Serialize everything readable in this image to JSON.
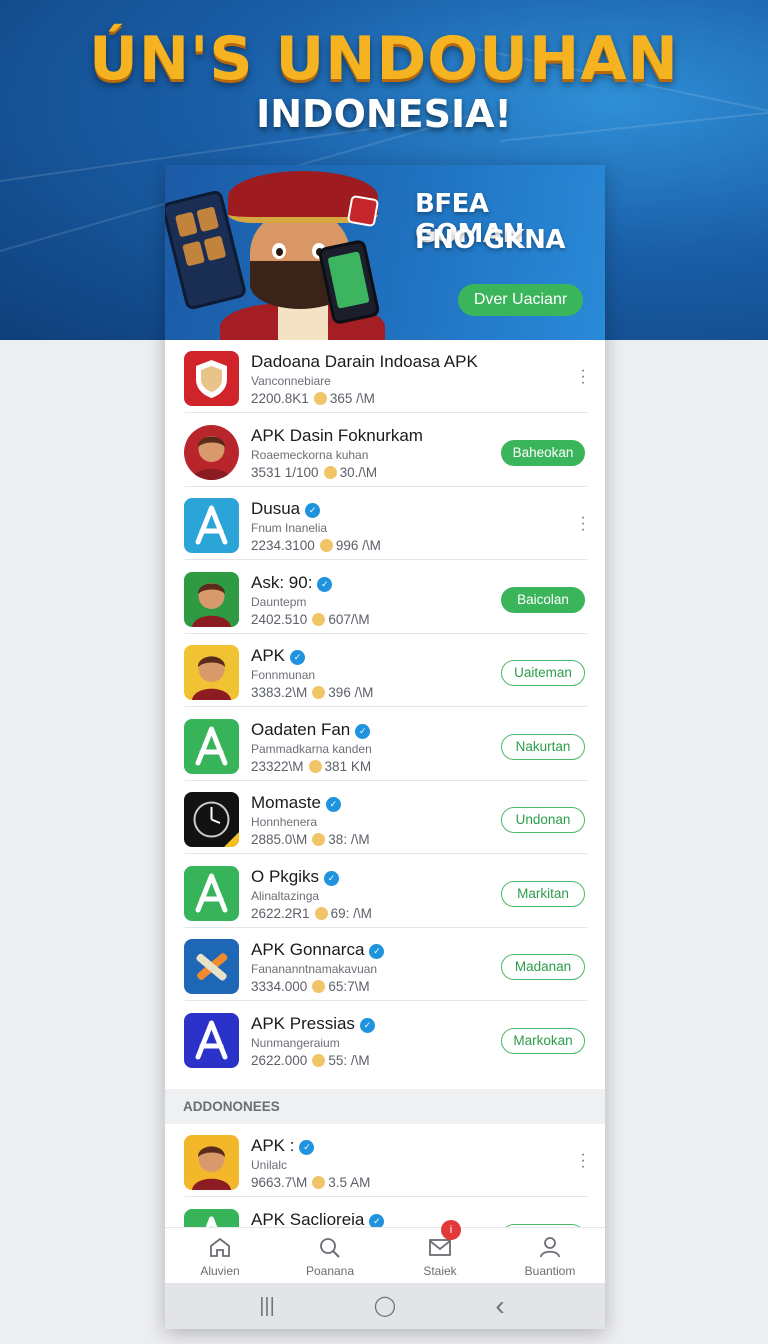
{
  "hero": {
    "title": "ÚN'S UNDOUHAN",
    "subtitle": "INDONESIA!"
  },
  "banner": {
    "line1": "BFEA GOMAN",
    "line2": "FNO GKNA",
    "button_label": "Dver Uacianr"
  },
  "apps": [
    {
      "name": "Dadoana Darain Indoasa APK",
      "developer": "Vanconnebiare",
      "downloads": "2200.8K1",
      "size": "365 /\\M",
      "action": "menu",
      "icon": "shield-icon",
      "icon_color": "#d0232a"
    },
    {
      "name": "APK Dasin Foknurkam",
      "developer": "Roaemeckorna kuhan",
      "downloads": "3531 1/100",
      "size": "30./\\M",
      "action": "solid",
      "button_label": "Baheokan",
      "icon": "avatar-icon",
      "icon_color": "#b8262c"
    },
    {
      "name": "Dusua",
      "developer": "Fnum Inanelia",
      "downloads": "2234.3100",
      "size": "996 /\\M",
      "action": "menu",
      "icon": "app-store-icon",
      "icon_color": "#2ba4d8"
    },
    {
      "name": "Ask: 90:",
      "developer": "Dauntepm",
      "downloads": "2402.510",
      "size": "607/\\M",
      "action": "solid",
      "button_label": "Baicolan",
      "icon": "avatar-icon",
      "icon_color": "#2e9b43"
    },
    {
      "name": "APK",
      "developer": "Fonnmunan",
      "downloads": "3383.2\\M",
      "size": "396 /\\M",
      "action": "outline",
      "button_label": "Uaiteman",
      "icon": "avatar-icon",
      "icon_color": "#f1c232"
    },
    {
      "name": "Oadaten Fan",
      "developer": "Pammadkarna kanden",
      "downloads": "23322\\M",
      "size": "381 KM",
      "action": "outline",
      "button_label": "Nakurtan",
      "icon": "app-store-icon",
      "icon_color": "#37b45a"
    },
    {
      "name": "Momaste",
      "developer": "Honnhenera",
      "downloads": "2885.0\\M",
      "size": "38: /\\M",
      "action": "outline",
      "button_label": "Undonan",
      "icon": "clock-icon",
      "icon_color": "#121212"
    },
    {
      "name": "O Pkgiks",
      "developer": "Alinaltazinga",
      "downloads": "2622.2R1",
      "size": "69: /\\M",
      "action": "outline",
      "button_label": "Markitan",
      "icon": "app-store-icon",
      "icon_color": "#37b45a"
    },
    {
      "name": "APK Gonnarca",
      "developer": "Fanananntnamakavuan",
      "downloads": "3334.000",
      "size": "65:7\\M",
      "action": "outline",
      "button_label": "Madanan",
      "icon": "tools-icon",
      "icon_color": "#1d67b6"
    },
    {
      "name": "APK Pressias",
      "developer": "Nunmangeraium",
      "downloads": "2622.000",
      "size": "55: /\\M",
      "action": "outline",
      "button_label": "Markokan",
      "icon": "app-store-icon",
      "icon_color": "#2a32c9"
    }
  ],
  "section_title": "ADDONONEES",
  "more_apps": [
    {
      "name": "APK :",
      "developer": "Unilalc",
      "downloads": "9663.7\\M",
      "size": "3.5 AM",
      "action": "menu",
      "icon": "avatar-icon",
      "icon_color": "#f3b72a"
    },
    {
      "name": "APK Saclioreia",
      "developer": "",
      "downloads": "",
      "size": "",
      "action": "outline",
      "button_label": "",
      "icon": "app-store-icon",
      "icon_color": "#37b45a"
    }
  ],
  "bottom_nav": {
    "items": [
      {
        "label": "Aluvien",
        "icon": "home-icon"
      },
      {
        "label": "Poanana",
        "icon": "search-icon"
      },
      {
        "label": "Staiek",
        "icon": "mail-icon",
        "badge": "i"
      },
      {
        "label": "Buantiom",
        "icon": "profile-icon"
      }
    ]
  },
  "system_nav": {
    "recents": "|||",
    "home": "◯",
    "back": "‹"
  }
}
